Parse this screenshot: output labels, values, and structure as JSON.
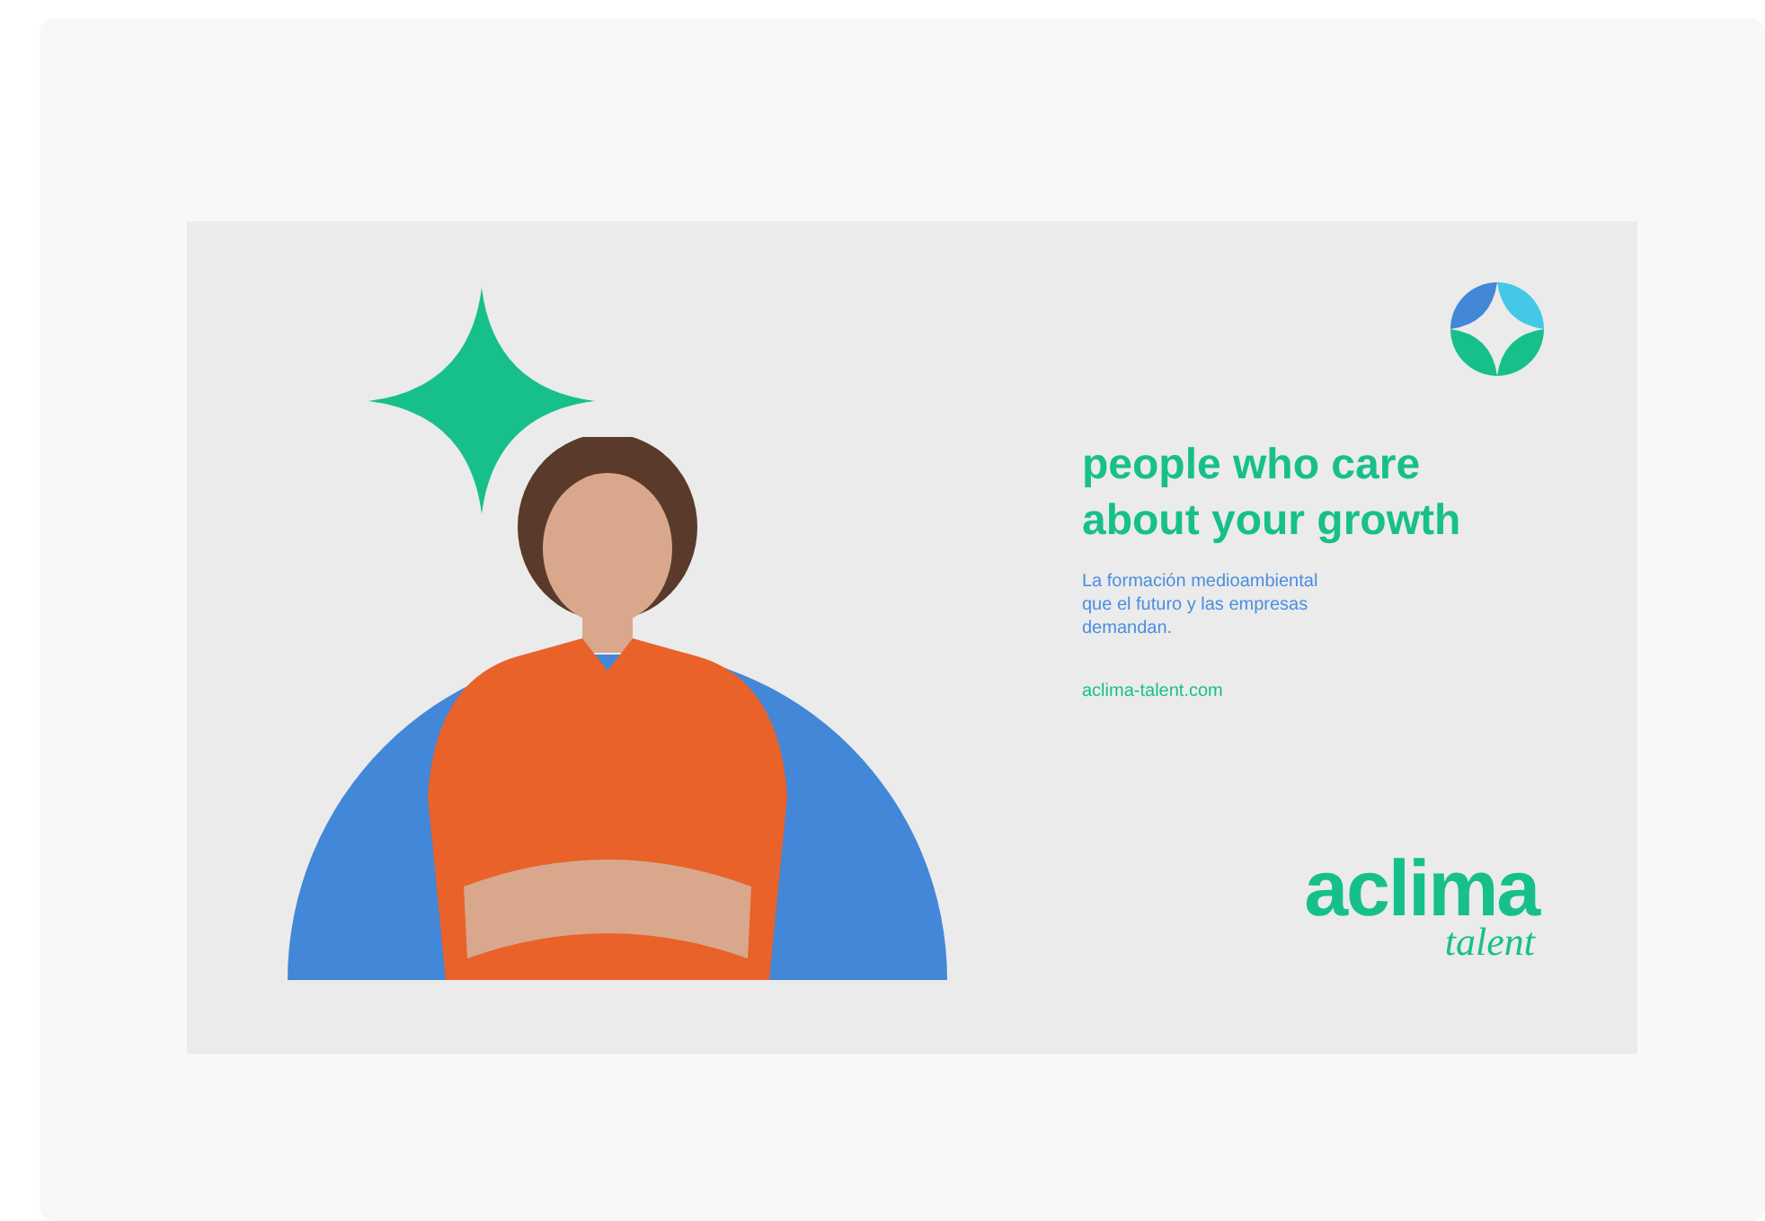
{
  "banner": {
    "headline_lines": [
      "people who care",
      "about your growth"
    ],
    "description_lines": [
      "La formación medioambiental",
      "que el futuro y las empresas",
      "demandan."
    ],
    "website": "aclima-talent.com",
    "logo": {
      "name": "aclima",
      "tagline": "talent"
    }
  }
}
